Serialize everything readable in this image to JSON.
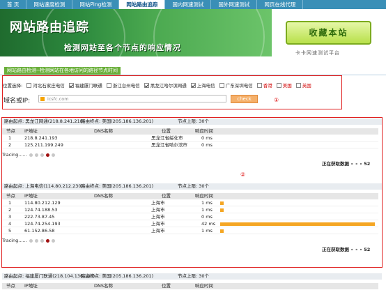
{
  "nav": {
    "tabs": [
      "首 页",
      "网站速度检测",
      "网站Ping检测",
      "网站路由追踪",
      "国内网速测试",
      "国外网速测试",
      "网页在线代理"
    ],
    "active": 3
  },
  "banner": {
    "title": "网站路由追踪",
    "subtitle": "检测网站至各个节点的响应情况",
    "favorite_button": "收藏本站",
    "slogan": "卡卡网速测试平台"
  },
  "tagline": "网站路由检测--检测网站在各地访问的路径节点时间",
  "form": {
    "location_label": "位置选择:",
    "locations": [
      {
        "label": "河北石家庄电信",
        "checked": false,
        "red": false
      },
      {
        "label": "福建厦门联通",
        "checked": true,
        "red": false
      },
      {
        "label": "浙江台州电信",
        "checked": false,
        "red": false
      },
      {
        "label": "黑龙江哈尔滨网通",
        "checked": true,
        "red": false
      },
      {
        "label": "上海电信",
        "checked": true,
        "red": false
      },
      {
        "label": "广东深圳电信",
        "checked": false,
        "red": false
      },
      {
        "label": "香港",
        "checked": false,
        "red": true
      },
      {
        "label": "美国",
        "checked": false,
        "red": true
      },
      {
        "label": "英国",
        "checked": false,
        "red": true
      }
    ],
    "domain_label": "域名或IP:",
    "domain_value": "icsfc.com",
    "check_button": "check",
    "marker": "①"
  },
  "results_marker": "②",
  "labels": {
    "start": "路由起点:",
    "end": "路由终点:",
    "limit": "节点上限:",
    "col_node": "节点",
    "col_ip": "IP地址",
    "col_dns": "DNS名称",
    "col_loc": "位置",
    "col_time": "响应时间",
    "tracing": "Tracing......",
    "loading": "正在获取数据"
  },
  "traces": [
    {
      "start": "黑龙江网通(218.8.241.218)",
      "end": "美国(205.186.136.201)",
      "limit": "30个",
      "rows": [
        {
          "n": "1",
          "ip": "218.8.241.193",
          "dns": "",
          "loc": "黑龙江省绥化市",
          "time": "0 ms",
          "bar": 0
        },
        {
          "n": "2",
          "ip": "125.211.199.249",
          "dns": "",
          "loc": "黑龙江省哈尔滨市",
          "time": "0 ms",
          "bar": 0
        }
      ],
      "active_dot": 3
    },
    {
      "start": "上海电信(114.80.212.230)",
      "end": "美国(205.186.136.201)",
      "limit": "30个",
      "rows": [
        {
          "n": "1",
          "ip": "114.80.212.129",
          "dns": "",
          "loc": "上海市",
          "time": "1 ms",
          "bar": 1
        },
        {
          "n": "2",
          "ip": "124.74.188.53",
          "dns": "",
          "loc": "上海市",
          "time": "1 ms",
          "bar": 1
        },
        {
          "n": "3",
          "ip": "222.73.87.45",
          "dns": "",
          "loc": "上海市",
          "time": "0 ms",
          "bar": 0
        },
        {
          "n": "4",
          "ip": "124.74.254.193",
          "dns": "",
          "loc": "上海市",
          "time": "42 ms",
          "bar": 42
        },
        {
          "n": "5",
          "ip": "61.152.86.58",
          "dns": "",
          "loc": "上海市",
          "time": "1 ms",
          "bar": 1
        }
      ],
      "active_dot": 3
    },
    {
      "start": "福建厦门联通(218.104.136.135)",
      "end": "美国(205.186.136.201)",
      "limit": "30个",
      "rows": []
    }
  ],
  "colors": {
    "nav": "#3a8fb7",
    "accent": "#6aaf3a",
    "border_red": "#e02020",
    "bar": "#f5a623"
  }
}
